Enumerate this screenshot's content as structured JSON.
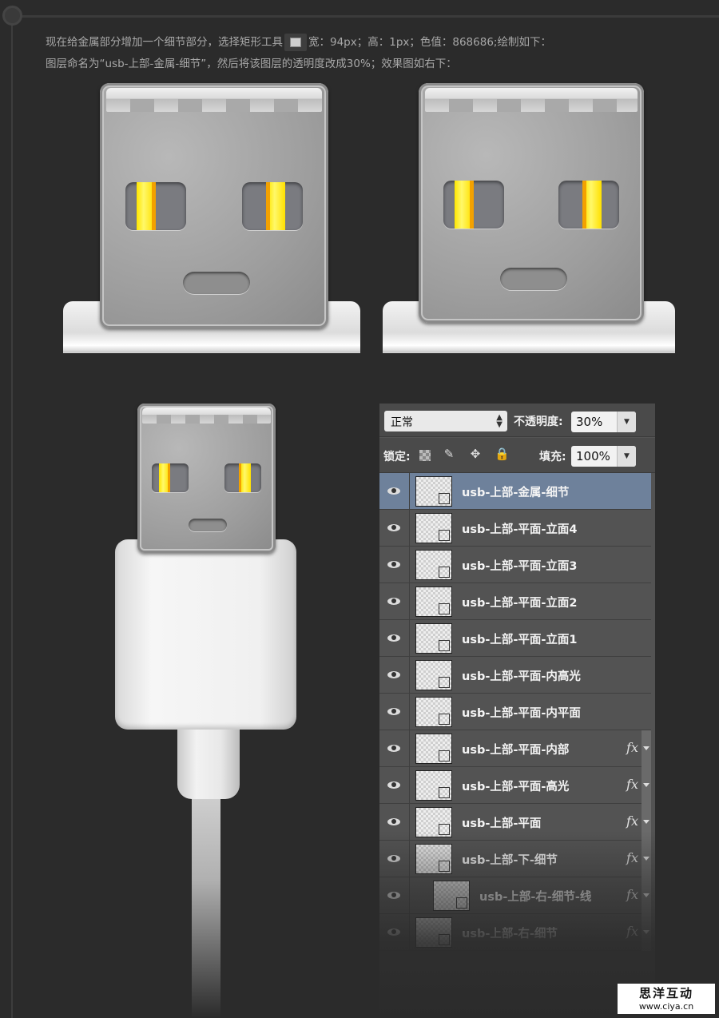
{
  "intro": {
    "line1_a": "现在给金属部分增加一个细节部分，选择矩形工具",
    "line1_b": "宽：94px；高：1px；色值：868686;绘制如下：",
    "line2": "图层命名为“usb-上部-金属-细节”，然后将该图层的透明度改成30%；效果图如右下："
  },
  "layers_panel": {
    "blend_mode": "正常",
    "opacity_label": "不透明度:",
    "opacity_value": "30%",
    "lock_label": "锁定:",
    "fill_label": "填充:",
    "fill_value": "100%",
    "icons": [
      "lock-transparent-icon",
      "brush-icon",
      "move-icon",
      "padlock-icon"
    ],
    "layers": [
      {
        "name": "usb-上部-金属-细节",
        "selected": true,
        "fx": false
      },
      {
        "name": "usb-上部-平面-立面4",
        "fx": false
      },
      {
        "name": "usb-上部-平面-立面3",
        "fx": false
      },
      {
        "name": "usb-上部-平面-立面2",
        "fx": false
      },
      {
        "name": "usb-上部-平面-立面1",
        "fx": false
      },
      {
        "name": "usb-上部-平面-内高光",
        "fx": false
      },
      {
        "name": "usb-上部-平面-内平面",
        "fx": false
      },
      {
        "name": "usb-上部-平面-内部",
        "fx": true
      },
      {
        "name": "usb-上部-平面-高光",
        "fx": true
      },
      {
        "name": "usb-上部-平面",
        "fx": true
      },
      {
        "name": "usb-上部-下-细节",
        "fx": true
      },
      {
        "name": "usb-上部-右-细节-线",
        "fx": true
      },
      {
        "name": "usb-上部-右-细节",
        "fx": true
      }
    ],
    "fx_label": "fx"
  },
  "watermark": {
    "name": "思洋互动",
    "url": "www.ciya.cn"
  },
  "colors": {
    "background": "#2b2b2b",
    "selected_layer": "#6e819b",
    "connector_yellow": "#ffe600",
    "connector_orange": "#f3a100"
  }
}
